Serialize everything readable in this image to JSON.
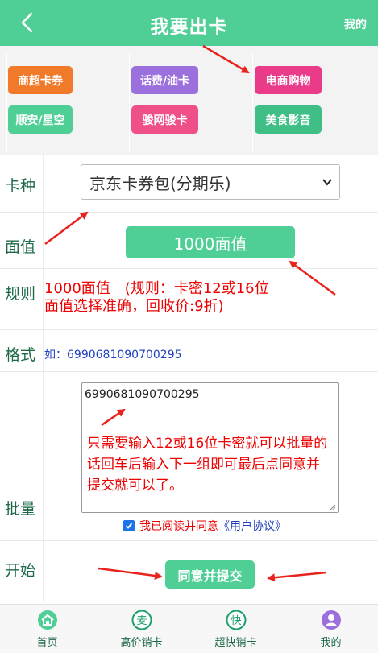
{
  "header": {
    "title": "我要出卡",
    "right_label": "我的"
  },
  "categories": [
    {
      "label": "商超卡券",
      "color": "#f07a2a"
    },
    {
      "label": "话费/油卡",
      "color": "#9b6fdc"
    },
    {
      "label": "电商购物",
      "color": "#ea3b8a"
    },
    {
      "label": "顺安/星空",
      "color": "#4fcf96"
    },
    {
      "label": "骏网骏卡",
      "color": "#f0508a"
    },
    {
      "label": "美食影音",
      "color": "#3fbf86"
    }
  ],
  "form": {
    "card_type_label": "卡种",
    "card_type_value": "京东卡券包(分期乐)",
    "face_label": "面值",
    "face_value": "1000面值",
    "rule_label": "规则",
    "rule_line1": "1000面值　(规则：卡密12或16位",
    "rule_line2": "面值选择准确，回收价:9折)",
    "format_label": "格式",
    "format_text": "如：6990681090700295",
    "batch_label": "批量",
    "batch_value": "6990681090700295",
    "batch_hint": "只需要输入12或16位卡密就可以批量的话回车后输入下一组即可最后点同意并提交就可以了。",
    "agree_text": "我已阅读并同意",
    "agree_link": "《用户协议》",
    "start_label": "开始",
    "submit_label": "同意并提交"
  },
  "tabbar": [
    {
      "label": "首页",
      "icon": "home-icon"
    },
    {
      "label": "高价销卡",
      "icon": "mai-icon",
      "glyph": "麦"
    },
    {
      "label": "超快销卡",
      "icon": "kuai-icon",
      "glyph": "快"
    },
    {
      "label": "我的",
      "icon": "user-icon"
    }
  ],
  "colors": {
    "primary": "#4fcf96",
    "label": "#1e6a48",
    "alert": "#e00000",
    "link": "#1f3fbf"
  }
}
